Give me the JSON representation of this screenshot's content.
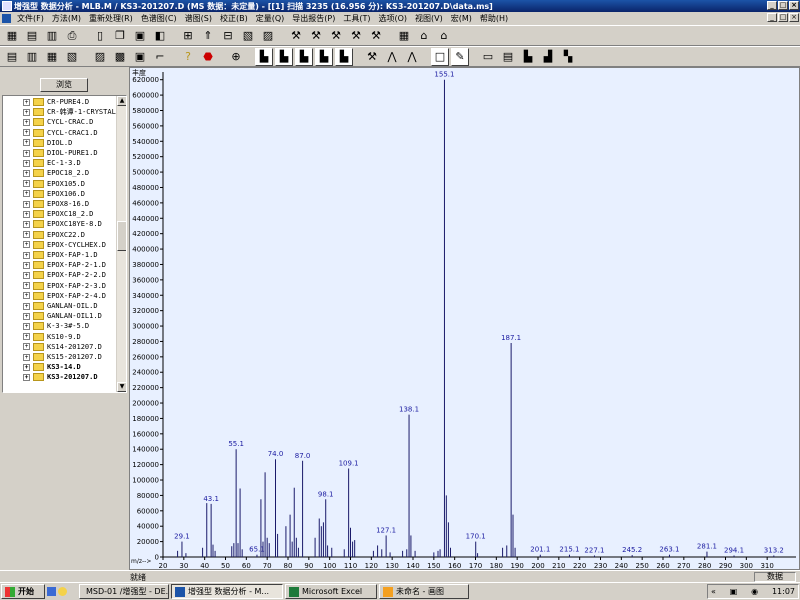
{
  "window": {
    "title": "增强型 数据分析 - MLB.M / KS3-201207.D    (MS 数据：未定量) - [[1] 扫描 3235 (16.956 分): KS3-201207.D\\data.ms]",
    "controls": [
      "_",
      "□",
      "×"
    ]
  },
  "menu": {
    "items": [
      "文件(F)",
      "方法(M)",
      "重新处理(R)",
      "色谱图(C)",
      "谱图(S)",
      "校正(B)",
      "定量(Q)",
      "导出报告(P)",
      "工具(T)",
      "选项(O)",
      "视图(V)",
      "宏(M)",
      "帮助(H)"
    ],
    "mdi_controls": [
      "_",
      "□",
      "×"
    ]
  },
  "sidebar": {
    "browse_label": "浏览",
    "tree_items": [
      {
        "label": "CR-PURE4.D",
        "bold": false
      },
      {
        "label": "CR-韩谭-1-CRYSTAL",
        "bold": false
      },
      {
        "label": "CYCL-CRAC.D",
        "bold": false
      },
      {
        "label": "CYCL-CRAC1.D",
        "bold": false
      },
      {
        "label": "DIOL.D",
        "bold": false
      },
      {
        "label": "DIOL-PURE1.D",
        "bold": false
      },
      {
        "label": "EC-1-3.D",
        "bold": false
      },
      {
        "label": "EPOC18_2.D",
        "bold": false
      },
      {
        "label": "EPOX105.D",
        "bold": false
      },
      {
        "label": "EPOX106.D",
        "bold": false
      },
      {
        "label": "EPOX8-16.D",
        "bold": false
      },
      {
        "label": "EPOXC18_2.D",
        "bold": false
      },
      {
        "label": "EPOXC18YE-8.D",
        "bold": false
      },
      {
        "label": "EPOXC22.D",
        "bold": false
      },
      {
        "label": "EPOX-CYCLHEX.D",
        "bold": false
      },
      {
        "label": "EPOX-FAP-1.D",
        "bold": false
      },
      {
        "label": "EPOX-FAP-2-1.D",
        "bold": false
      },
      {
        "label": "EPOX-FAP-2-2.D",
        "bold": false
      },
      {
        "label": "EPOX-FAP-2-3.D",
        "bold": false
      },
      {
        "label": "EPOX-FAP-2-4.D",
        "bold": false
      },
      {
        "label": "GANLAN-OIL.D",
        "bold": false
      },
      {
        "label": "GANLAN-OIL1.D",
        "bold": false
      },
      {
        "label": "K-3-3#-5.D",
        "bold": false
      },
      {
        "label": "KS10-9.D",
        "bold": false
      },
      {
        "label": "KS14-201207.D",
        "bold": false
      },
      {
        "label": "KS15-201207.D",
        "bold": false
      },
      {
        "label": "KS3-14.D",
        "bold": true
      },
      {
        "label": "KS3-201207.D",
        "bold": true
      }
    ]
  },
  "status": {
    "text": "就绪",
    "panel": "数据"
  },
  "taskbar": {
    "start": "开始",
    "tasks": [
      "MSD-01 /增强型 - DE...",
      "增强型 数据分析 - M...",
      "Microsoft Excel",
      "未命名 - 画图"
    ],
    "active_index": 1,
    "clock": "11:07"
  },
  "colors": {
    "title_bar": "#0a246a",
    "chart_bg": "#e8f0ff",
    "chart_line": "#1a1a6a",
    "peak_label": "#1a1aa0"
  },
  "chart_data": {
    "type": "bar",
    "ylabel": "丰度",
    "xlabel": "m/z-->",
    "xlim": [
      20,
      320
    ],
    "ylim": [
      0,
      630000
    ],
    "xticks": [
      20,
      30,
      40,
      50,
      60,
      70,
      80,
      90,
      100,
      110,
      120,
      130,
      140,
      150,
      160,
      170,
      180,
      190,
      200,
      210,
      220,
      230,
      240,
      250,
      260,
      270,
      280,
      290,
      300,
      310
    ],
    "yticks": [
      0,
      20000,
      40000,
      60000,
      80000,
      100000,
      120000,
      140000,
      160000,
      180000,
      200000,
      220000,
      240000,
      260000,
      280000,
      300000,
      320000,
      340000,
      360000,
      380000,
      400000,
      420000,
      440000,
      460000,
      480000,
      500000,
      520000,
      540000,
      560000,
      580000,
      600000,
      620000
    ],
    "peaks": [
      {
        "mz": 27,
        "y": 8000
      },
      {
        "mz": 29.1,
        "y": 20000,
        "label": "29.1"
      },
      {
        "mz": 31,
        "y": 5000
      },
      {
        "mz": 39,
        "y": 12000
      },
      {
        "mz": 41,
        "y": 70000
      },
      {
        "mz": 43.1,
        "y": 69000,
        "label": "43.1"
      },
      {
        "mz": 44,
        "y": 16000
      },
      {
        "mz": 45,
        "y": 8000
      },
      {
        "mz": 53,
        "y": 14000
      },
      {
        "mz": 54,
        "y": 18000
      },
      {
        "mz": 55.1,
        "y": 140000,
        "label": "55.1"
      },
      {
        "mz": 56,
        "y": 18000
      },
      {
        "mz": 57,
        "y": 89000
      },
      {
        "mz": 58,
        "y": 10000
      },
      {
        "mz": 65.1,
        "y": 3000,
        "label": "65.1"
      },
      {
        "mz": 67,
        "y": 75000
      },
      {
        "mz": 68,
        "y": 20000
      },
      {
        "mz": 69,
        "y": 110000
      },
      {
        "mz": 70,
        "y": 25000
      },
      {
        "mz": 71,
        "y": 18000
      },
      {
        "mz": 74.0,
        "y": 127000,
        "label": "74.0"
      },
      {
        "mz": 75,
        "y": 30000
      },
      {
        "mz": 79,
        "y": 40000
      },
      {
        "mz": 81,
        "y": 55000
      },
      {
        "mz": 82,
        "y": 20000
      },
      {
        "mz": 83,
        "y": 90000
      },
      {
        "mz": 84,
        "y": 25000
      },
      {
        "mz": 85,
        "y": 12000
      },
      {
        "mz": 87.0,
        "y": 125000,
        "label": "87.0"
      },
      {
        "mz": 93,
        "y": 25000
      },
      {
        "mz": 95,
        "y": 50000
      },
      {
        "mz": 96,
        "y": 40000
      },
      {
        "mz": 97,
        "y": 45000
      },
      {
        "mz": 98.1,
        "y": 75000,
        "label": "98.1"
      },
      {
        "mz": 99,
        "y": 15000
      },
      {
        "mz": 101,
        "y": 12000
      },
      {
        "mz": 107,
        "y": 10000
      },
      {
        "mz": 109.1,
        "y": 115000,
        "label": "109.1"
      },
      {
        "mz": 110,
        "y": 38000
      },
      {
        "mz": 111,
        "y": 20000
      },
      {
        "mz": 112,
        "y": 22000
      },
      {
        "mz": 121,
        "y": 8000
      },
      {
        "mz": 123,
        "y": 15000
      },
      {
        "mz": 125,
        "y": 10000
      },
      {
        "mz": 127.1,
        "y": 28000,
        "label": "127.1"
      },
      {
        "mz": 129,
        "y": 6000
      },
      {
        "mz": 135,
        "y": 8000
      },
      {
        "mz": 137,
        "y": 10000
      },
      {
        "mz": 138.1,
        "y": 185000,
        "label": "138.1"
      },
      {
        "mz": 139,
        "y": 28000
      },
      {
        "mz": 141,
        "y": 8000
      },
      {
        "mz": 150,
        "y": 6000
      },
      {
        "mz": 152,
        "y": 8000
      },
      {
        "mz": 153,
        "y": 10000
      },
      {
        "mz": 155.1,
        "y": 620000,
        "label": "155.1"
      },
      {
        "mz": 156,
        "y": 80000
      },
      {
        "mz": 157,
        "y": 45000
      },
      {
        "mz": 158,
        "y": 12000
      },
      {
        "mz": 170.1,
        "y": 20000,
        "label": "170.1"
      },
      {
        "mz": 171,
        "y": 5000
      },
      {
        "mz": 183,
        "y": 12000
      },
      {
        "mz": 185,
        "y": 15000
      },
      {
        "mz": 187.1,
        "y": 278000,
        "label": "187.1"
      },
      {
        "mz": 188,
        "y": 55000
      },
      {
        "mz": 189,
        "y": 12000
      },
      {
        "mz": 201.1,
        "y": 3000,
        "label": "201.1"
      },
      {
        "mz": 215.1,
        "y": 3000,
        "label": "215.1"
      },
      {
        "mz": 227.1,
        "y": 2000,
        "label": "227.1"
      },
      {
        "mz": 245.2,
        "y": 2500,
        "label": "245.2"
      },
      {
        "mz": 263.1,
        "y": 3000,
        "label": "263.1"
      },
      {
        "mz": 281.1,
        "y": 7000,
        "label": "281.1"
      },
      {
        "mz": 294.1,
        "y": 2000,
        "label": "294.1"
      },
      {
        "mz": 313.2,
        "y": 2000,
        "label": "313.2"
      }
    ]
  }
}
